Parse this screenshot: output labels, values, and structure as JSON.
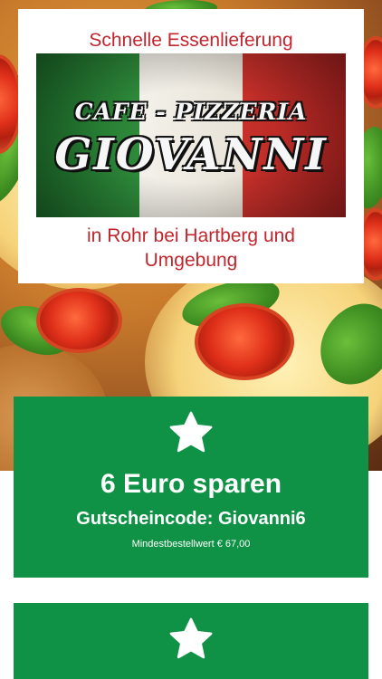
{
  "header": {
    "tagline_top": "Schnelle Essenlieferung",
    "tagline_bottom_line1": "in Rohr bei Hartberg und",
    "tagline_bottom_line2": "Umgebung",
    "logo": {
      "line1": "CAFE - PIZZERIA",
      "line2": "GIOVANNI",
      "flag_colors": [
        "#1d6b2a",
        "#f4f1ea",
        "#c8302a"
      ]
    }
  },
  "promos": [
    {
      "icon": "star-icon",
      "title": "6 Euro sparen",
      "code": "Gutscheincode: Giovanni6",
      "note": "Mindestbestellwert € 67,00"
    },
    {
      "icon": "star-icon"
    }
  ],
  "colors": {
    "accent_red": "#c0262d",
    "promo_green": "#0f9245"
  }
}
